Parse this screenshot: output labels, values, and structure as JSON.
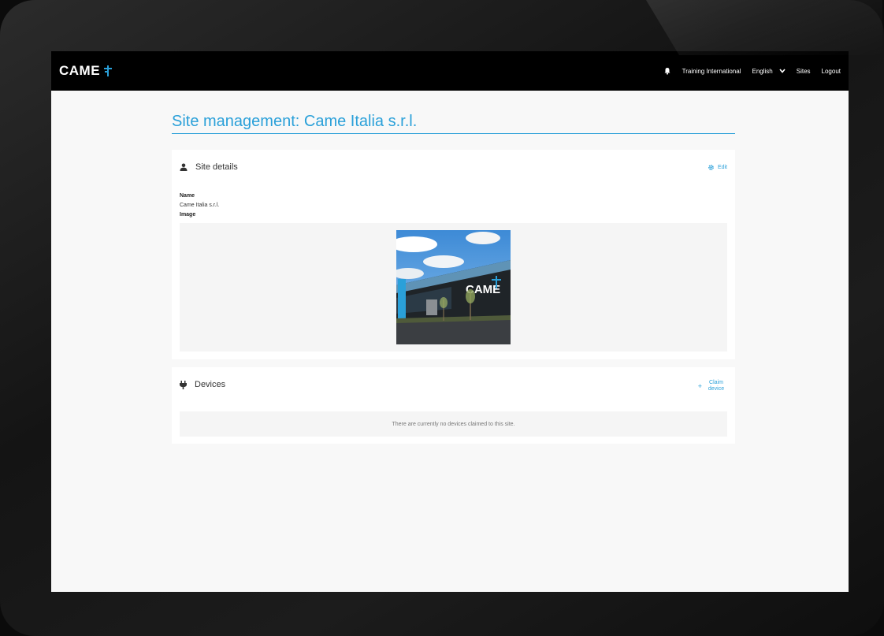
{
  "header": {
    "logo_text": "CAME",
    "notifications_icon": "bell-icon",
    "account": "Training International",
    "language": "English",
    "sites_link": "Sites",
    "logout_link": "Logout"
  },
  "page": {
    "title": "Site management: Came Italia s.r.l."
  },
  "site_details": {
    "heading": "Site details",
    "edit_label": "Edit",
    "name_label": "Name",
    "name_value": "Came Italia s.r.l.",
    "image_label": "Image",
    "image_signage": "CAME"
  },
  "devices": {
    "heading": "Devices",
    "claim_label": "Claim device",
    "empty_message": "There are currently no devices claimed to this site."
  },
  "colors": {
    "accent": "#2aa0d9",
    "topbar": "#000000",
    "background": "#f8f8f8"
  }
}
